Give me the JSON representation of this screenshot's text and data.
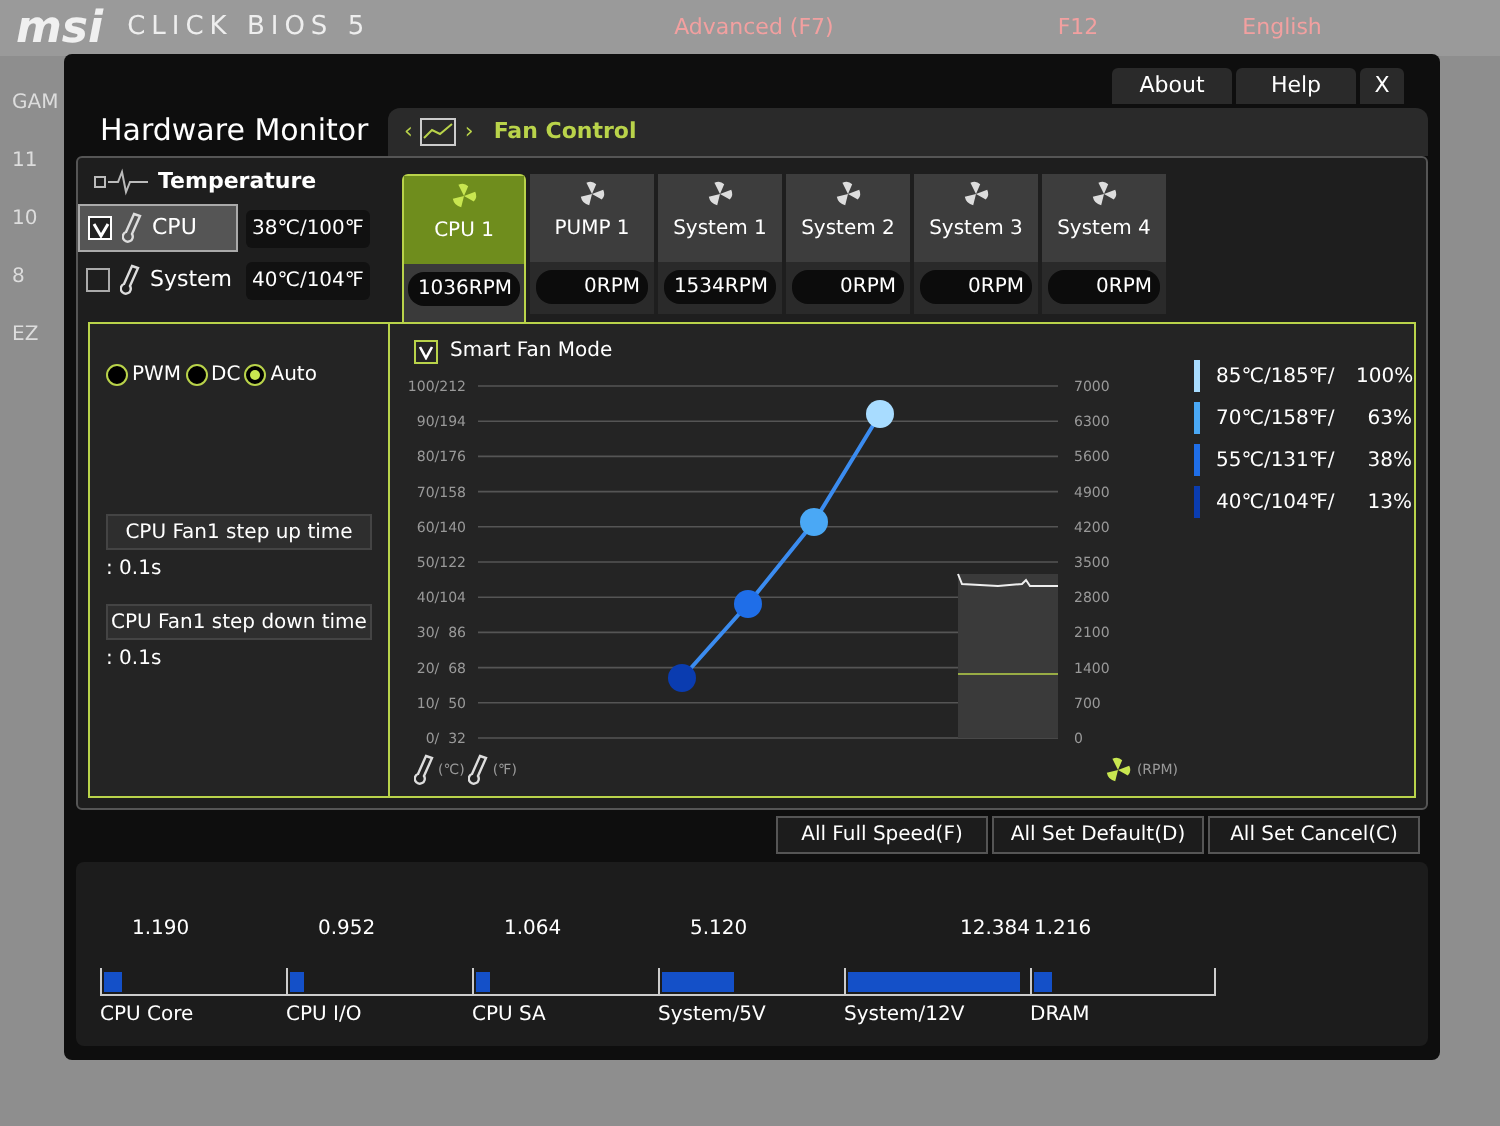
{
  "background": {
    "logo": "msi",
    "product": "CLICK BIOS 5",
    "mode": "Advanced (F7)",
    "screenshot_key": "F12",
    "language": "English",
    "side_labels": [
      "GAM",
      "11",
      "10",
      "8",
      "EZ"
    ]
  },
  "window": {
    "title": "Hardware Monitor",
    "buttons": [
      "About",
      "Help",
      "X"
    ]
  },
  "fan_control": {
    "nav_prev": "‹",
    "nav_next": "›",
    "title": "Fan Control"
  },
  "temperature": {
    "title": "Temperature",
    "sensors": [
      {
        "name": "CPU",
        "selected": true,
        "checked": true,
        "reading": "38℃/100℉"
      },
      {
        "name": "System",
        "selected": false,
        "checked": false,
        "reading": "40℃/104℉"
      }
    ]
  },
  "fans": [
    {
      "name": "CPU 1",
      "selected": true,
      "rpm": "1036RPM"
    },
    {
      "name": "PUMP 1",
      "selected": false,
      "rpm": "0RPM"
    },
    {
      "name": "System 1",
      "selected": false,
      "rpm": "1534RPM"
    },
    {
      "name": "System 2",
      "selected": false,
      "rpm": "0RPM"
    },
    {
      "name": "System 3",
      "selected": false,
      "rpm": "0RPM"
    },
    {
      "name": "System 4",
      "selected": false,
      "rpm": "0RPM"
    }
  ],
  "modes": [
    {
      "label": "PWM",
      "selected": false
    },
    {
      "label": "DC",
      "selected": false
    },
    {
      "label": "Auto",
      "selected": true
    }
  ],
  "step_up": {
    "label": "CPU Fan1 step up time",
    "value": ": 0.1s"
  },
  "step_down": {
    "label": "CPU Fan1 step down time",
    "value": ": 0.1s"
  },
  "smart_fan": {
    "label": "Smart Fan Mode",
    "checked": true
  },
  "chart": {
    "y_labels": [
      "100/212",
      "90/194",
      "80/176",
      "70/158",
      "60/140",
      "50/122",
      "40/104",
      "30/  86",
      "20/  68",
      "10/  50",
      "0/  32"
    ],
    "rpm_ticks": [
      "7000",
      "6300",
      "5600",
      "4900",
      "4200",
      "3500",
      "2800",
      "2100",
      "1400",
      "700",
      "0"
    ],
    "unit_c": "(℃)",
    "unit_f": "(℉)",
    "unit_rpm": "(RPM)"
  },
  "legend": [
    {
      "label": "85℃/185℉/",
      "percent": "100%",
      "color": "#a8dcff"
    },
    {
      "label": "70℃/158℉/",
      "percent": "63%",
      "color": "#4aa8f5"
    },
    {
      "label": "55℃/131℉/",
      "percent": "38%",
      "color": "#1f6ee8"
    },
    {
      "label": "40℃/104℉/",
      "percent": "13%",
      "color": "#0a3cb0"
    }
  ],
  "actions": [
    "All Full Speed(F)",
    "All Set Default(D)",
    "All Set Cancel(C)"
  ],
  "voltages": [
    {
      "name": "CPU Core",
      "value": "1.190",
      "level": 0.1
    },
    {
      "name": "CPU I/O",
      "value": "0.952",
      "level": 0.08
    },
    {
      "name": "CPU SA",
      "value": "1.064",
      "level": 0.08
    },
    {
      "name": "System/5V",
      "value": "5.120",
      "level": 0.4
    },
    {
      "name": "System/12V",
      "value": "12.384",
      "level": 0.95
    },
    {
      "name": "DRAM",
      "value": "1.216",
      "level": 0.1
    }
  ]
}
